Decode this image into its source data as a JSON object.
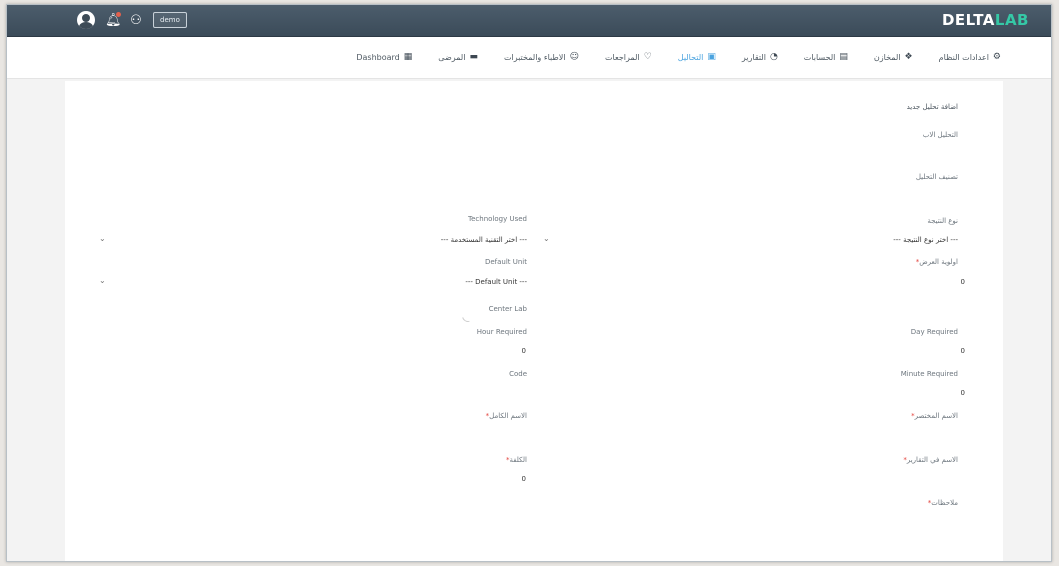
{
  "header": {
    "brand_part1": "DELTA",
    "brand_part2": "LAB",
    "user_label": "demo",
    "brand_color": "#35c8a6"
  },
  "nav": [
    {
      "label": "Dashboard",
      "icon": "grid-icon",
      "active": false
    },
    {
      "label": "المرضى",
      "icon": "bed-icon",
      "active": false
    },
    {
      "label": "الاطباء والمختبرات",
      "icon": "doctor-icon",
      "active": false
    },
    {
      "label": "المراجعات",
      "icon": "heart-icon",
      "active": false
    },
    {
      "label": "التحاليل",
      "icon": "briefcase-icon",
      "active": true
    },
    {
      "label": "التقارير",
      "icon": "pie-chart-icon",
      "active": false
    },
    {
      "label": "الحسابات",
      "icon": "money-icon",
      "active": false
    },
    {
      "label": "المخازن",
      "icon": "store-icon",
      "active": false
    },
    {
      "label": "اعدادات النظام",
      "icon": "gear-icon",
      "active": false
    }
  ],
  "form": {
    "title": "اضافة تحليل جديد",
    "parent_label": "التحليل الاب",
    "category_label": "تصنيف التحليل",
    "result_type_label": "نوع النتيجة",
    "result_type_value": "--- اختر نوع النتيجة ---",
    "technology_label": "Technology Used",
    "technology_value": "--- اختر التقنية المستخدمة ---",
    "priority_label": "اولوية العرض",
    "priority_value": "0",
    "default_unit_label": "Default Unit",
    "default_unit_value": "--- Default Unit ---",
    "center_lab_label": "Center Lab",
    "day_required_label": "Day Required",
    "day_required_value": "0",
    "hour_required_label": "Hour Required",
    "hour_required_value": "0",
    "minute_required_label": "Minute Required",
    "minute_required_value": "0",
    "code_label": "Code",
    "short_name_label": "الاسم المختصر",
    "full_name_label": "الاسم الكامل",
    "report_name_label": "الاسم في التقارير",
    "cost_label": "الكلفة",
    "cost_value": "0",
    "notes_label": "ملاحظات",
    "required_mark": "*"
  }
}
